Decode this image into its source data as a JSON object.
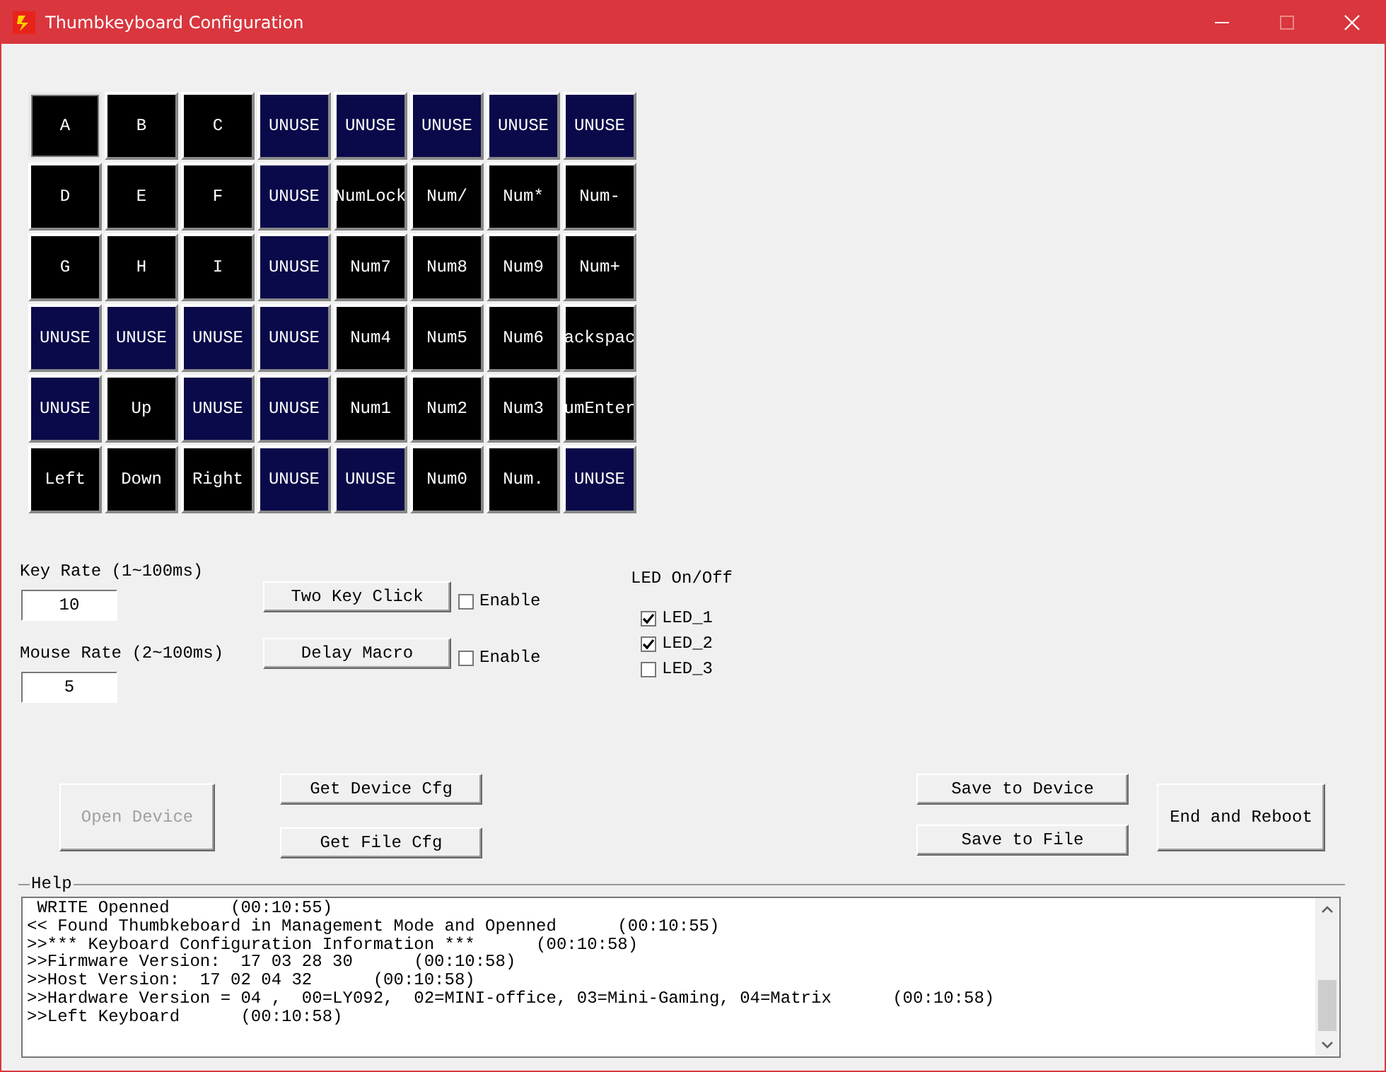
{
  "window": {
    "title": "Thumbkeyboard Configuration"
  },
  "key_rows": [
    {
      "keys": [
        {
          "label": "A",
          "kind": "mapped",
          "selected": true
        },
        {
          "label": "B",
          "kind": "mapped",
          "selected": false
        },
        {
          "label": "C",
          "kind": "mapped",
          "selected": false
        },
        {
          "label": "UNUSE",
          "kind": "unused",
          "selected": false
        },
        {
          "label": "UNUSE",
          "kind": "unused",
          "selected": false
        },
        {
          "label": "UNUSE",
          "kind": "unused",
          "selected": false
        },
        {
          "label": "UNUSE",
          "kind": "unused",
          "selected": false
        },
        {
          "label": "UNUSE",
          "kind": "unused",
          "selected": false
        }
      ]
    },
    {
      "keys": [
        {
          "label": "D",
          "kind": "mapped",
          "selected": false
        },
        {
          "label": "E",
          "kind": "mapped",
          "selected": false
        },
        {
          "label": "F",
          "kind": "mapped",
          "selected": false
        },
        {
          "label": "UNUSE",
          "kind": "unused",
          "selected": false
        },
        {
          "label": "NumLock",
          "kind": "mapped",
          "selected": false
        },
        {
          "label": "Num/",
          "kind": "mapped",
          "selected": false
        },
        {
          "label": "Num*",
          "kind": "mapped",
          "selected": false
        },
        {
          "label": "Num-",
          "kind": "mapped",
          "selected": false
        }
      ]
    },
    {
      "keys": [
        {
          "label": "G",
          "kind": "mapped",
          "selected": false
        },
        {
          "label": "H",
          "kind": "mapped",
          "selected": false
        },
        {
          "label": "I",
          "kind": "mapped",
          "selected": false
        },
        {
          "label": "UNUSE",
          "kind": "unused",
          "selected": false
        },
        {
          "label": "Num7",
          "kind": "mapped",
          "selected": false
        },
        {
          "label": "Num8",
          "kind": "mapped",
          "selected": false
        },
        {
          "label": "Num9",
          "kind": "mapped",
          "selected": false
        },
        {
          "label": "Num+",
          "kind": "mapped",
          "selected": false
        }
      ]
    },
    {
      "keys": [
        {
          "label": "UNUSE",
          "kind": "unused",
          "selected": false
        },
        {
          "label": "UNUSE",
          "kind": "unused",
          "selected": false
        },
        {
          "label": "UNUSE",
          "kind": "unused",
          "selected": false
        },
        {
          "label": "UNUSE",
          "kind": "unused",
          "selected": false
        },
        {
          "label": "Num4",
          "kind": "mapped",
          "selected": false
        },
        {
          "label": "Num5",
          "kind": "mapped",
          "selected": false
        },
        {
          "label": "Num6",
          "kind": "mapped",
          "selected": false
        },
        {
          "label": "ackspac",
          "kind": "mapped",
          "selected": false
        }
      ]
    },
    {
      "keys": [
        {
          "label": "UNUSE",
          "kind": "unused",
          "selected": false
        },
        {
          "label": "Up",
          "kind": "mapped",
          "selected": false
        },
        {
          "label": "UNUSE",
          "kind": "unused",
          "selected": false
        },
        {
          "label": "UNUSE",
          "kind": "unused",
          "selected": false
        },
        {
          "label": "Num1",
          "kind": "mapped",
          "selected": false
        },
        {
          "label": "Num2",
          "kind": "mapped",
          "selected": false
        },
        {
          "label": "Num3",
          "kind": "mapped",
          "selected": false
        },
        {
          "label": "umEnter",
          "kind": "mapped",
          "selected": false
        }
      ]
    },
    {
      "keys": [
        {
          "label": "Left",
          "kind": "mapped",
          "selected": false
        },
        {
          "label": "Down",
          "kind": "mapped",
          "selected": false
        },
        {
          "label": "Right",
          "kind": "mapped",
          "selected": false
        },
        {
          "label": "UNUSE",
          "kind": "unused",
          "selected": false
        },
        {
          "label": "UNUSE",
          "kind": "unused",
          "selected": false
        },
        {
          "label": "Num0",
          "kind": "mapped",
          "selected": false
        },
        {
          "label": "Num.",
          "kind": "mapped",
          "selected": false
        },
        {
          "label": "UNUSE",
          "kind": "unused",
          "selected": false
        }
      ]
    }
  ],
  "rates": [
    {
      "label": "Key Rate (1~100ms)",
      "value": "10"
    },
    {
      "label": "Mouse Rate (2~100ms)",
      "value": "5"
    }
  ],
  "toggles": [
    {
      "button": "Two Key Click",
      "enable_label": "Enable",
      "checked": false
    },
    {
      "button": "Delay Macro",
      "enable_label": "Enable",
      "checked": false
    }
  ],
  "led": {
    "title": "LED On/Off",
    "items": [
      {
        "label": "LED_1",
        "checked": true
      },
      {
        "label": "LED_2",
        "checked": true
      },
      {
        "label": "LED_3",
        "checked": false
      }
    ]
  },
  "open_button": {
    "label": "Open Device",
    "disabled": true
  },
  "get_buttons": [
    "Get Device Cfg",
    "Get File Cfg"
  ],
  "save_buttons": [
    "Save to Device",
    "Save to File"
  ],
  "reboot_button": {
    "label": "End and Reboot",
    "disabled": false
  },
  "help": {
    "title": "Help",
    "lines": [
      " WRITE Openned      (00:10:55)",
      "<< Found Thumbkeboard in Management Mode and Openned      (00:10:55)",
      ">>*** Keyboard Configuration Information ***      (00:10:58)",
      ">>Firmware Version:  17 03 28 30      (00:10:58)",
      ">>Host Version:  17 02 04 32      (00:10:58)",
      ">>Hardware Version = 04 ,  00=LY092,  02=MINI-office, 03=Mini-Gaming, 04=Matrix      (00:10:58)",
      ">>Left Keyboard      (00:10:58)"
    ]
  }
}
